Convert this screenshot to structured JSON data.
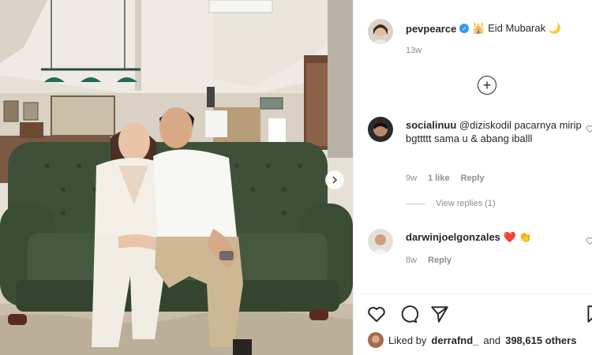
{
  "post": {
    "username": "pevpearce",
    "caption": "🕌 Eid Mubarak 🌙",
    "time": "13w"
  },
  "comments": [
    {
      "username": "socialinuu",
      "text": "@diziskodil pacarnya mirip bgttttt sama u & abang iballl",
      "time": "9w",
      "likes": "1 like",
      "reply_label": "Reply",
      "view_replies": "View replies (1)"
    },
    {
      "username": "darwinjoelgonzales",
      "text": "❤️ 👏",
      "time": "8w",
      "reply_label": "Reply"
    }
  ],
  "liked_by": {
    "prefix": "Liked by",
    "user": "derrafnd_",
    "middle": "and",
    "count": "398,615 others"
  },
  "icons": {
    "verified": "verified-badge-icon",
    "load_more": "plus-circle-icon",
    "carousel": "chevron-right-icon",
    "like": "heart-icon",
    "comment": "comment-bubble-icon",
    "share": "paper-plane-icon",
    "save": "bookmark-icon"
  },
  "colors": {
    "verified_blue": "#3897f0",
    "heart_red": "#ed4956",
    "muted_gray": "#8e8e8e",
    "sofa_green": "#3e5138"
  }
}
